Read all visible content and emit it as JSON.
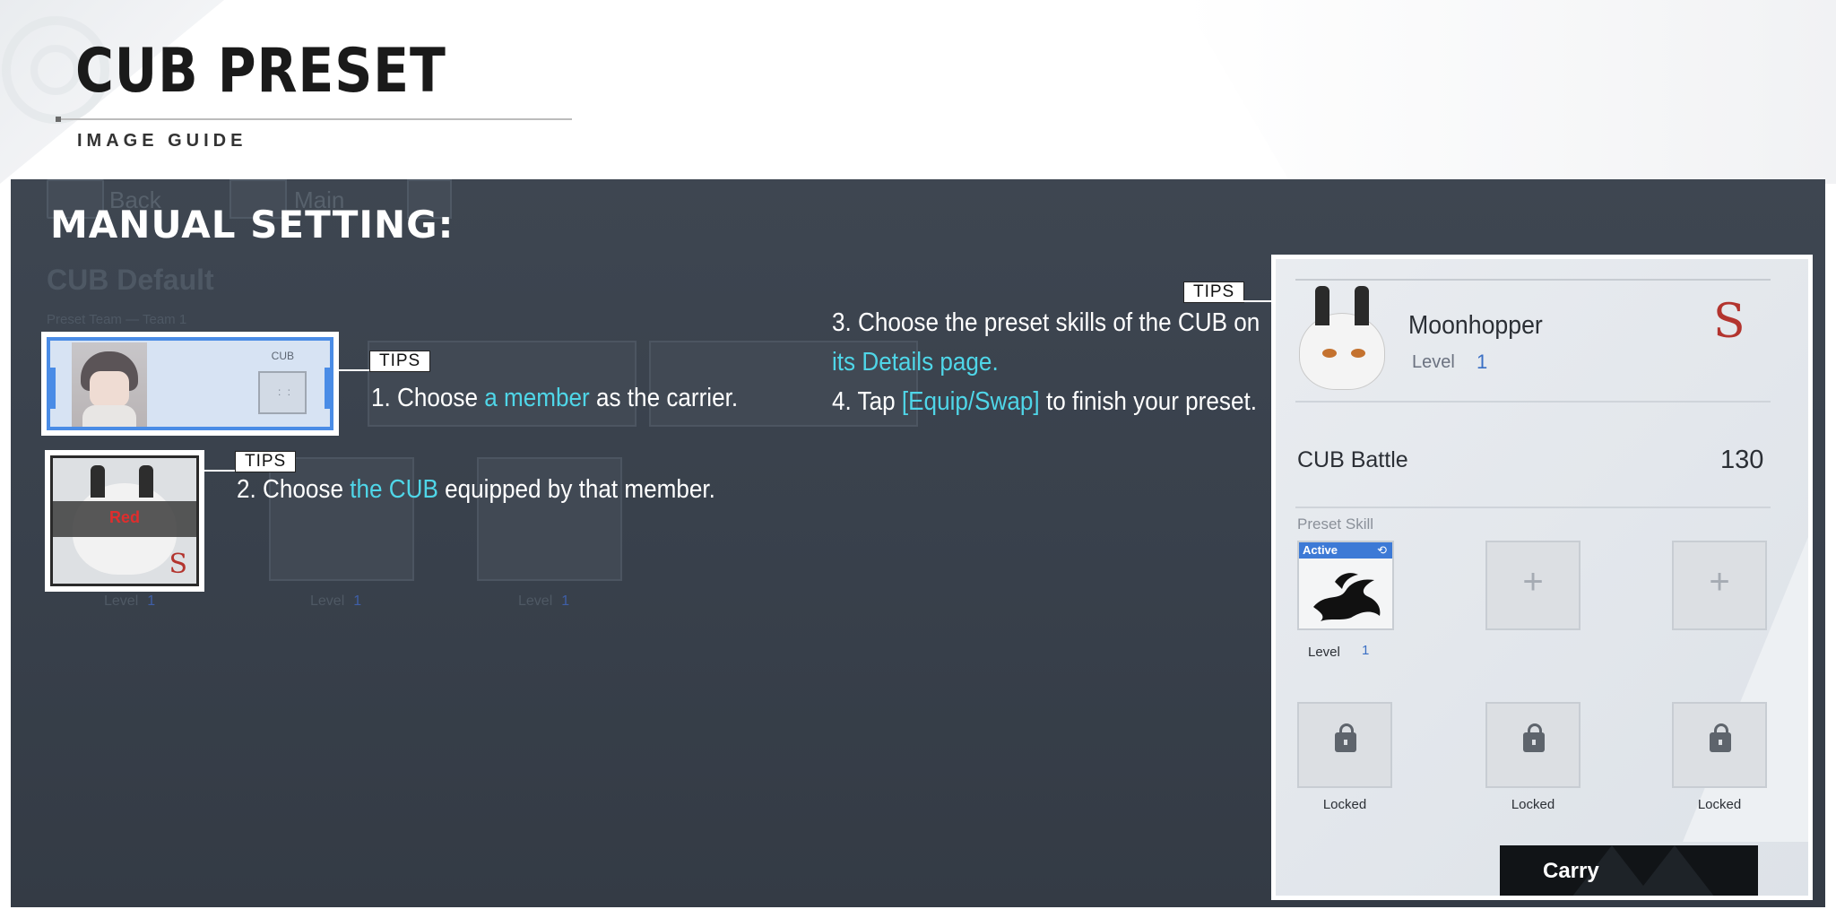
{
  "header": {
    "title": "CUB PRESET",
    "subtitle": "IMAGE GUIDE"
  },
  "panel": {
    "heading": "MANUAL SETTING:",
    "background_ui": {
      "back_label": "Back",
      "main_label": "Main",
      "page_title": "CUB Default",
      "preset_team": "Preset Team — Team 1",
      "cub_label": "CUB",
      "level_label": "Level",
      "level_value": "1"
    }
  },
  "tips_label": "TIPS",
  "steps": {
    "step1": {
      "prefix": "1. Choose ",
      "highlight": "a member",
      "suffix": " as the carrier."
    },
    "step2": {
      "prefix": "2. Choose ",
      "highlight": "the CUB",
      "suffix": " equipped by that member."
    },
    "step3": {
      "line1": "3. Choose the preset skills of the CUB on",
      "highlight": "its Details page."
    },
    "step4": {
      "prefix": "4. Tap ",
      "highlight": "[Equip/Swap]",
      "suffix": " to finish your preset."
    }
  },
  "member_card": {
    "cub_label": "CUB",
    "slot_glyph": ": :"
  },
  "cub_card": {
    "status": "Red",
    "rank": "S"
  },
  "details": {
    "name": "Moonhopper",
    "level_label": "Level",
    "level_value": "1",
    "rank": "S",
    "battle_label": "CUB Battle",
    "battle_value": "130",
    "preset_skill_label": "Preset Skill",
    "active_tag": "Active",
    "skill_level_label": "Level",
    "skill_level_value": "1",
    "plus_glyph": "+",
    "locked_labels": [
      "Locked",
      "Locked",
      "Locked"
    ],
    "carry_label": "Carry"
  },
  "colors": {
    "panel_bg": "#3a424d",
    "highlight_text": "#4fd6e8",
    "member_border": "#4a8ce6",
    "rank_red": "#b3342e",
    "level_blue": "#3a6fc4",
    "carry_button": "#111417"
  }
}
